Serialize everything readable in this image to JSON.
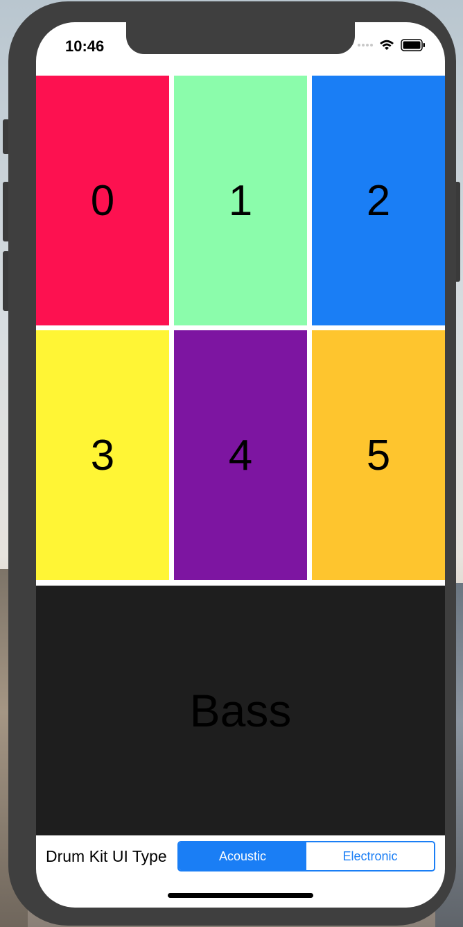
{
  "status_bar": {
    "time": "10:46",
    "wifi_icon": "wifi-icon",
    "battery_icon": "battery-icon"
  },
  "pads": [
    {
      "label": "0",
      "color": "#fd1150"
    },
    {
      "label": "1",
      "color": "#8bfcab"
    },
    {
      "label": "2",
      "color": "#1a7ef5"
    },
    {
      "label": "3",
      "color": "#fff535"
    },
    {
      "label": "4",
      "color": "#7d15a1"
    },
    {
      "label": "5",
      "color": "#fec52e"
    }
  ],
  "bass_pad": {
    "label": "Bass",
    "color": "#1e1e1e"
  },
  "control": {
    "label": "Drum Kit UI Type",
    "options": [
      "Acoustic",
      "Electronic"
    ],
    "selected": "Acoustic"
  },
  "colors": {
    "accent": "#1a7ef5"
  }
}
